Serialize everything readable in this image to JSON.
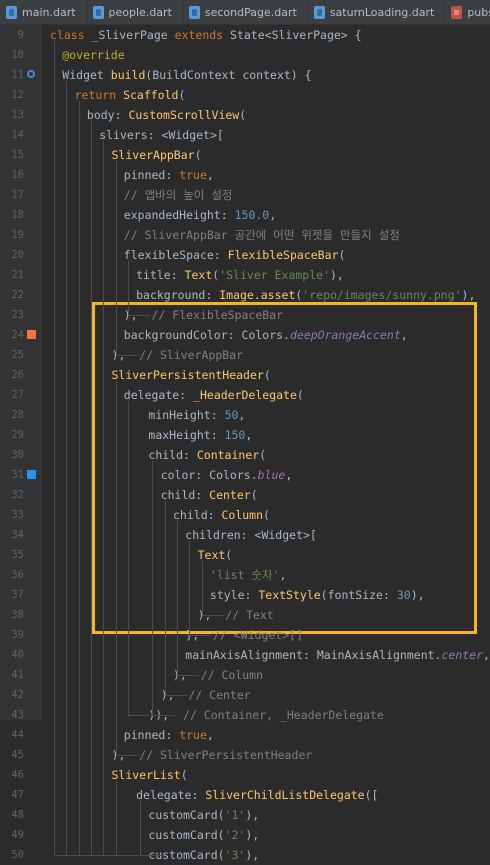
{
  "tabs": [
    {
      "label": "main.dart",
      "icon": "dart-file-icon"
    },
    {
      "label": "people.dart",
      "icon": "dart-file-icon"
    },
    {
      "label": "secondPage.dart",
      "icon": "dart-file-icon"
    },
    {
      "label": "saturnLoading.dart",
      "icon": "dart-file-icon"
    },
    {
      "label": "pubspec.yaml",
      "icon": "yaml-file-icon"
    }
  ],
  "gutter_markers": {
    "11": {
      "icon": "override-icon",
      "color": "#4a88c7"
    },
    "24": {
      "icon": "color-swatch-icon",
      "color": "#ff6e40"
    },
    "31": {
      "icon": "color-swatch-icon",
      "color": "#2196f3"
    }
  },
  "highlight_color": "#f5b51b",
  "lines": [
    {
      "n": "9",
      "indent": 0,
      "tokens": [
        [
          "kw",
          "class "
        ],
        [
          "",
          "_SliverPage "
        ],
        [
          "kw",
          "extends "
        ],
        [
          "",
          "State<SliverPage> {"
        ]
      ]
    },
    {
      "n": "10",
      "indent": 1,
      "tokens": [
        [
          "an",
          "@override"
        ]
      ]
    },
    {
      "n": "11",
      "indent": 1,
      "tokens": [
        [
          "",
          "Widget "
        ],
        [
          "ty",
          "build"
        ],
        [
          "",
          "(BuildContext context) {"
        ]
      ]
    },
    {
      "n": "12",
      "indent": 2,
      "tokens": [
        [
          "kw",
          "return "
        ],
        [
          "ty",
          "Scaffold"
        ],
        [
          "",
          "("
        ]
      ]
    },
    {
      "n": "13",
      "indent": 3,
      "tokens": [
        [
          "",
          "body: "
        ],
        [
          "ty",
          "CustomScrollView"
        ],
        [
          "",
          "("
        ]
      ]
    },
    {
      "n": "14",
      "indent": 4,
      "tokens": [
        [
          "",
          "slivers: <Widget>["
        ]
      ]
    },
    {
      "n": "15",
      "indent": 5,
      "tokens": [
        [
          "ty",
          "SliverAppBar"
        ],
        [
          "",
          "("
        ]
      ]
    },
    {
      "n": "16",
      "indent": 6,
      "tokens": [
        [
          "",
          "pinned: "
        ],
        [
          "kw",
          "true"
        ],
        [
          "",
          ","
        ]
      ]
    },
    {
      "n": "17",
      "indent": 6,
      "tokens": [
        [
          "cm",
          "// 앱바의 높이 설정"
        ]
      ]
    },
    {
      "n": "18",
      "indent": 6,
      "tokens": [
        [
          "",
          "expandedHeight: "
        ],
        [
          "nu",
          "150.0"
        ],
        [
          "",
          ","
        ]
      ]
    },
    {
      "n": "19",
      "indent": 6,
      "tokens": [
        [
          "cm",
          "// SliverAppBar 공간에 어떤 위젯을 만들지 설정"
        ]
      ]
    },
    {
      "n": "20",
      "indent": 6,
      "tokens": [
        [
          "",
          "flexibleSpace: "
        ],
        [
          "ty",
          "FlexibleSpaceBar"
        ],
        [
          "",
          "("
        ]
      ]
    },
    {
      "n": "21",
      "indent": 7,
      "tokens": [
        [
          "",
          "title: "
        ],
        [
          "ty",
          "Text"
        ],
        [
          "",
          "("
        ],
        [
          "st",
          "'Sliver Example'"
        ],
        [
          "",
          "),"
        ]
      ]
    },
    {
      "n": "22",
      "indent": 7,
      "tokens": [
        [
          "",
          "background: "
        ],
        [
          "ty",
          "Image.asset"
        ],
        [
          "",
          "("
        ],
        [
          "st",
          "'repo/images/sunny.png'"
        ],
        [
          "",
          "),"
        ]
      ]
    },
    {
      "n": "23",
      "indent": 6,
      "tokens": [
        [
          "",
          "),  "
        ],
        [
          "cm",
          "// FlexibleSpaceBar"
        ]
      ]
    },
    {
      "n": "24",
      "indent": 6,
      "tokens": [
        [
          "",
          "backgroundColor: Colors."
        ],
        [
          "it",
          "deepOrangeAccent"
        ],
        [
          "",
          ","
        ]
      ]
    },
    {
      "n": "25",
      "indent": 5,
      "tokens": [
        [
          "",
          "),  "
        ],
        [
          "cm",
          "// SliverAppBar"
        ]
      ]
    },
    {
      "n": "26",
      "indent": 5,
      "tokens": [
        [
          "ty",
          "SliverPersistentHeader"
        ],
        [
          "",
          "("
        ]
      ]
    },
    {
      "n": "27",
      "indent": 6,
      "tokens": [
        [
          "",
          "delegate: "
        ],
        [
          "ty",
          "_HeaderDelegate"
        ],
        [
          "",
          "("
        ]
      ]
    },
    {
      "n": "28",
      "indent": 8,
      "tokens": [
        [
          "",
          "minHeight: "
        ],
        [
          "nu",
          "50"
        ],
        [
          "",
          ","
        ]
      ]
    },
    {
      "n": "29",
      "indent": 8,
      "tokens": [
        [
          "",
          "maxHeight: "
        ],
        [
          "nu",
          "150"
        ],
        [
          "",
          ","
        ]
      ]
    },
    {
      "n": "30",
      "indent": 8,
      "tokens": [
        [
          "",
          "child: "
        ],
        [
          "ty",
          "Container"
        ],
        [
          "",
          "("
        ]
      ]
    },
    {
      "n": "31",
      "indent": 9,
      "tokens": [
        [
          "",
          "color: Colors."
        ],
        [
          "it",
          "blue"
        ],
        [
          "",
          ","
        ]
      ]
    },
    {
      "n": "32",
      "indent": 9,
      "tokens": [
        [
          "",
          "child: "
        ],
        [
          "ty",
          "Center"
        ],
        [
          "",
          "("
        ]
      ]
    },
    {
      "n": "33",
      "indent": 10,
      "tokens": [
        [
          "",
          "child: "
        ],
        [
          "ty",
          "Column"
        ],
        [
          "",
          "("
        ]
      ]
    },
    {
      "n": "34",
      "indent": 11,
      "tokens": [
        [
          "",
          "children: <Widget>["
        ]
      ]
    },
    {
      "n": "35",
      "indent": 12,
      "tokens": [
        [
          "ty",
          "Text"
        ],
        [
          "",
          "("
        ]
      ]
    },
    {
      "n": "36",
      "indent": 13,
      "tokens": [
        [
          "st",
          "'list 숫자'"
        ],
        [
          "",
          ","
        ]
      ]
    },
    {
      "n": "37",
      "indent": 13,
      "tokens": [
        [
          "",
          "style: "
        ],
        [
          "ty",
          "TextStyle"
        ],
        [
          "",
          "(fontSize: "
        ],
        [
          "nu",
          "30"
        ],
        [
          "",
          "),"
        ]
      ]
    },
    {
      "n": "38",
      "indent": 12,
      "tokens": [
        [
          "",
          "),  "
        ],
        [
          "cm",
          "// Text"
        ]
      ]
    },
    {
      "n": "39",
      "indent": 11,
      "tokens": [
        [
          "",
          "],  "
        ],
        [
          "cm",
          "// <Widget>[]"
        ]
      ]
    },
    {
      "n": "40",
      "indent": 11,
      "tokens": [
        [
          "",
          "mainAxisAlignment: MainAxisAlignment."
        ],
        [
          "it",
          "center"
        ],
        [
          "",
          ","
        ]
      ]
    },
    {
      "n": "41",
      "indent": 10,
      "tokens": [
        [
          "",
          "),  "
        ],
        [
          "cm",
          "// Column"
        ]
      ]
    },
    {
      "n": "42",
      "indent": 9,
      "tokens": [
        [
          "",
          "),  "
        ],
        [
          "cm",
          "// Center"
        ]
      ]
    },
    {
      "n": "43",
      "indent": 8,
      "tokens": [
        [
          "",
          ")),  "
        ],
        [
          "cm",
          "// Container, _HeaderDelegate"
        ]
      ]
    },
    {
      "n": "44",
      "indent": 6,
      "tokens": [
        [
          "",
          "pinned: "
        ],
        [
          "kw",
          "true"
        ],
        [
          "",
          ","
        ]
      ]
    },
    {
      "n": "45",
      "indent": 5,
      "tokens": [
        [
          "",
          "),  "
        ],
        [
          "cm",
          "// SliverPersistentHeader"
        ]
      ]
    },
    {
      "n": "46",
      "indent": 5,
      "tokens": [
        [
          "ty",
          "SliverList"
        ],
        [
          "",
          "("
        ]
      ]
    },
    {
      "n": "47",
      "indent": 7,
      "tokens": [
        [
          "",
          "delegate: "
        ],
        [
          "ty",
          "SliverChildListDelegate"
        ],
        [
          "",
          "(["
        ]
      ]
    },
    {
      "n": "48",
      "indent": 8,
      "tokens": [
        [
          "",
          "customCard("
        ],
        [
          "st",
          "'1'"
        ],
        [
          "",
          "),"
        ]
      ]
    },
    {
      "n": "49",
      "indent": 8,
      "tokens": [
        [
          "",
          "customCard("
        ],
        [
          "st",
          "'2'"
        ],
        [
          "",
          "),"
        ]
      ]
    },
    {
      "n": "50",
      "indent": 8,
      "tokens": [
        [
          "",
          "customCard("
        ],
        [
          "st",
          "'3'"
        ],
        [
          "",
          "),"
        ]
      ]
    }
  ]
}
